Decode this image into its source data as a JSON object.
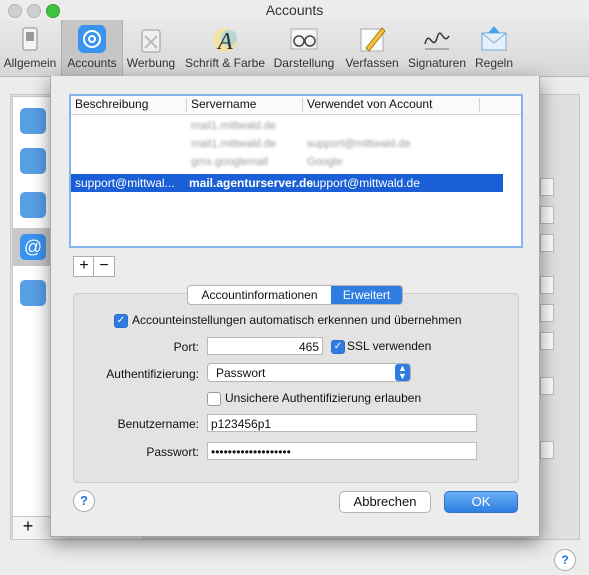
{
  "window": {
    "title": "Accounts"
  },
  "toolbar": {
    "items": [
      {
        "label": "Allgemein",
        "icon": "switch-icon"
      },
      {
        "label": "Accounts",
        "icon": "at-icon",
        "selected": true
      },
      {
        "label": "Werbung",
        "icon": "trash-icon"
      },
      {
        "label": "Schrift & Farbe",
        "icon": "font-icon"
      },
      {
        "label": "Darstellung",
        "icon": "glasses-icon"
      },
      {
        "label": "Verfassen",
        "icon": "pencil-icon"
      },
      {
        "label": "Signaturen",
        "icon": "signature-icon"
      },
      {
        "label": "Regeln",
        "icon": "envelope-icon"
      }
    ]
  },
  "smtp_table": {
    "headers": [
      "Beschreibung",
      "Servername",
      "Verwendet von Account"
    ],
    "blurred_rows": [
      [
        "",
        "mail1.mittwald.de",
        ""
      ],
      [
        "",
        "mail1.mittwald.de",
        "support@mittwald.de"
      ],
      [
        "",
        "gmx.googlemail",
        "Google"
      ]
    ],
    "selected_row": [
      "support@mittwal...",
      "mail.agenturserver.de",
      "support@mittwald.de"
    ]
  },
  "list_buttons": {
    "add": "+",
    "remove": "−"
  },
  "tabs": {
    "info": "Accountinformationen",
    "advanced": "Erweitert"
  },
  "advanced": {
    "auto_detect_label": "Accounteinstellungen automatisch erkennen und übernehmen",
    "auto_detect_checked": true,
    "port_label": "Port:",
    "port_value": "465",
    "ssl_label": "SSL verwenden",
    "ssl_checked": true,
    "auth_label": "Authentifizierung:",
    "auth_value": "Passwort",
    "insecure_label": "Unsichere Authentifizierung erlauben",
    "insecure_checked": false,
    "username_label": "Benutzername:",
    "username_value": "p123456p1",
    "password_label": "Passwort:",
    "password_value": "•••••••••••••••••••"
  },
  "buttons": {
    "help": "?",
    "cancel": "Abbrechen",
    "ok": "OK"
  },
  "background": {
    "add": "+",
    "help": "?"
  },
  "colors": {
    "accent": "#2f7de1",
    "selection": "#1a5fd6"
  }
}
